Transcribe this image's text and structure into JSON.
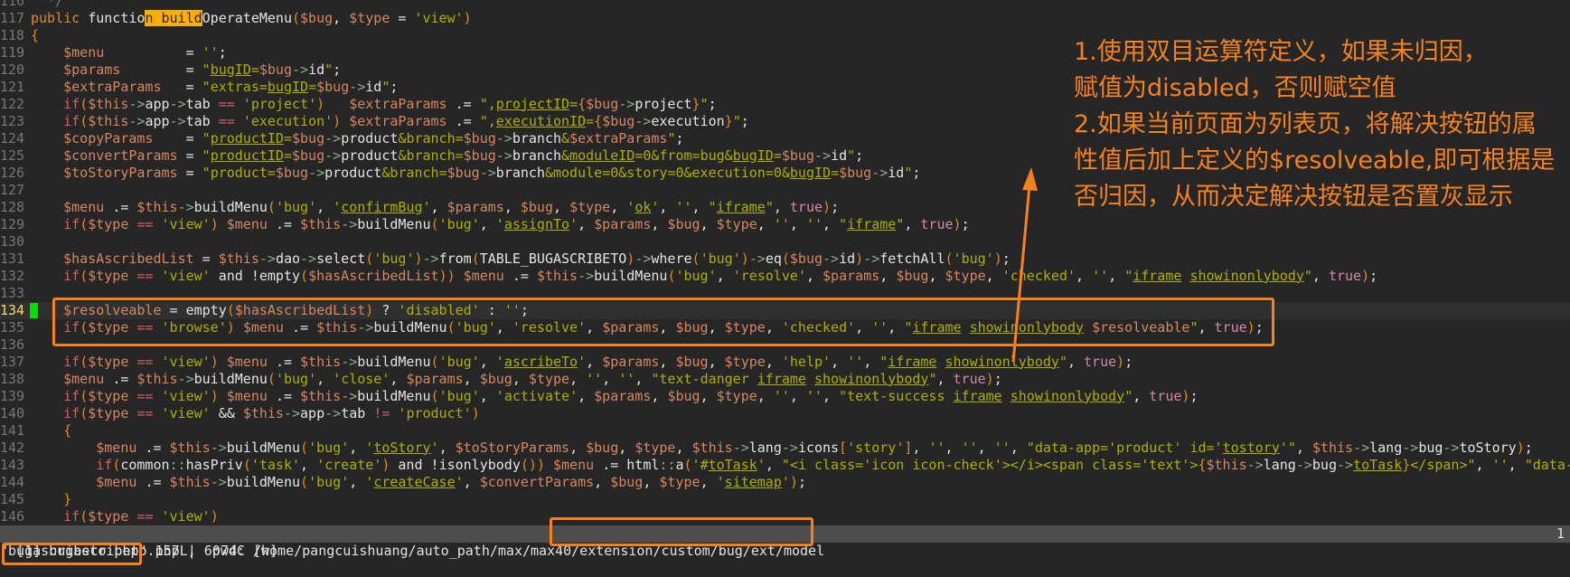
{
  "editor": {
    "search_match": "n build",
    "cursor_line": "134",
    "lines": [
      {
        "num": "116",
        "code": "  */"
      },
      {
        "num": "117",
        "code": "public function buildOperateMenu($bug, $type = 'view')"
      },
      {
        "num": "118",
        "code": "{"
      },
      {
        "num": "119",
        "code": "    $menu          = '';"
      },
      {
        "num": "120",
        "code": "    $params        = \"bugID=$bug->id\";"
      },
      {
        "num": "121",
        "code": "    $extraParams   = \"extras=bugID=$bug->id\";"
      },
      {
        "num": "122",
        "code": "    if($this->app->tab == 'project')   $extraParams .= \",projectID={$bug->project}\";"
      },
      {
        "num": "123",
        "code": "    if($this->app->tab == 'execution') $extraParams .= \",executionID={$bug->execution}\";"
      },
      {
        "num": "124",
        "code": "    $copyParams    = \"productID=$bug->product&branch=$bug->branch&$extraParams\";"
      },
      {
        "num": "125",
        "code": "    $convertParams = \"productID=$bug->product&branch=$bug->branch&moduleID=0&from=bug&bugID=$bug->id\";"
      },
      {
        "num": "126",
        "code": "    $toStoryParams = \"product=$bug->product&branch=$bug->branch&module=0&story=0&execution=0&bugID=$bug->id\";"
      },
      {
        "num": "127",
        "code": ""
      },
      {
        "num": "128",
        "code": "    $menu .= $this->buildMenu('bug', 'confirmBug', $params, $bug, $type, 'ok', '', \"iframe\", true);"
      },
      {
        "num": "129",
        "code": "    if($type == 'view') $menu .= $this->buildMenu('bug', 'assignTo', $params, $bug, $type, '', '', \"iframe\", true);"
      },
      {
        "num": "130",
        "code": ""
      },
      {
        "num": "131",
        "code": "    $hasAscribedList = $this->dao->select('bug')->from(TABLE_BUGASCRIBETO)->where('bug')->eq($bug->id)->fetchAll('bug');"
      },
      {
        "num": "132",
        "code": "    if($type == 'view' and !empty($hasAscribedList)) $menu .= $this->buildMenu('bug', 'resolve', $params, $bug, $type, 'checked', '', \"iframe showinonlybody\", true);"
      },
      {
        "num": "133",
        "code": ""
      },
      {
        "num": "134",
        "code": "    $resolveable = empty($hasAscribedList) ? 'disabled' : '';"
      },
      {
        "num": "135",
        "code": "    if($type == 'browse') $menu .= $this->buildMenu('bug', 'resolve', $params, $bug, $type, 'checked', '', \"iframe showinonlybody $resolveable\", true);"
      },
      {
        "num": "136",
        "code": ""
      },
      {
        "num": "137",
        "code": "    if($type == 'view') $menu .= $this->buildMenu('bug', 'ascribeTo', $params, $bug, $type, 'help', '', \"iframe showinonlybody\", true);"
      },
      {
        "num": "138",
        "code": "    $menu .= $this->buildMenu('bug', 'close', $params, $bug, $type, '', '', \"text-danger iframe showinonlybody\", true);"
      },
      {
        "num": "139",
        "code": "    if($type == 'view') $menu .= $this->buildMenu('bug', 'activate', $params, $bug, $type, '', '', \"text-success iframe showinonlybody\", true);"
      },
      {
        "num": "140",
        "code": "    if($type == 'view' && $this->app->tab != 'product')"
      },
      {
        "num": "141",
        "code": "    {"
      },
      {
        "num": "142",
        "code": "        $menu .= $this->buildMenu('bug', 'toStory', $toStoryParams, $bug, $type, $this->lang->icons['story'], '', '', '', \"data-app='product' id='tostory'\", $this->lang->bug->toStory);"
      },
      {
        "num": "143",
        "code": "        if(common::hasPriv('task', 'create') and !isonlybody()) $menu .= html::a('#toTask', \"<i class='icon icon-check'></i><span class='text'>{$this->lang->bug->toTask}</span>\", '', \"data-a"
      },
      {
        "num": "144",
        "code": "        $menu .= $this->buildMenu('bug', 'createCase', $convertParams, $bug, $type, 'sitemap');"
      },
      {
        "num": "145",
        "code": "    }"
      },
      {
        "num": "146",
        "code": "    if($type == 'view')"
      }
    ]
  },
  "statusline": {
    "left": "[1] bugascribeto.php |  pwd: /home/pangcuishuang/auto_path/max/max40/extension/custom/bug/ext/model",
    "right": "1"
  },
  "cmdline": "\"bugascribeto.php\" 157L, 6074C [w]",
  "annotation": {
    "lines": [
      "1.使用双目运算符定义，如果未归因，",
      "赋值为disabled，否则赋空值",
      "2.如果当前页面为列表页，将解决按钮的属",
      "性值后加上定义的$resolveable,即可根据是",
      "否归因，从而决定解决按钮是否置灰显示"
    ]
  },
  "colors": {
    "annotation": "#f5821f",
    "background": "#262626",
    "sign": "#00e000"
  }
}
